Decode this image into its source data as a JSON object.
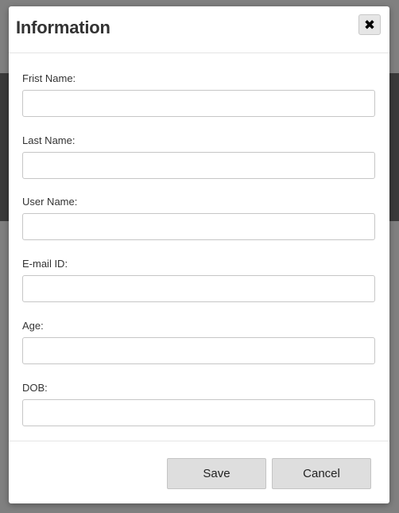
{
  "dialog": {
    "title": "Information",
    "close_icon": "close-icon"
  },
  "fields": {
    "first_name": {
      "label": "Frist Name:",
      "value": ""
    },
    "last_name": {
      "label": "Last Name:",
      "value": ""
    },
    "user_name": {
      "label": "User Name:",
      "value": ""
    },
    "email": {
      "label": "E-mail ID:",
      "value": ""
    },
    "age": {
      "label": "Age:",
      "value": ""
    },
    "dob": {
      "label": "DOB:",
      "value": ""
    }
  },
  "footer": {
    "save_label": "Save",
    "cancel_label": "Cancel"
  }
}
